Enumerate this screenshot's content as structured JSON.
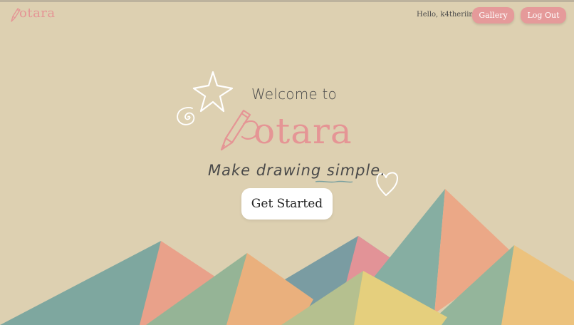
{
  "nav": {
    "logo_text": "otara",
    "greeting": "Hello, k4theriina!",
    "gallery_label": "Gallery",
    "logout_label": "Log Out"
  },
  "hero": {
    "welcome": "Welcome to",
    "logo_text": "otara",
    "tagline": "Make drawing simple.",
    "cta_label": "Get Started"
  },
  "colors": {
    "background": "#ddd0b1",
    "accent_pink": "#e59595",
    "text_dark": "#4a4a4a",
    "mountain_teal": "#7ea79f",
    "mountain_salmon": "#e9a18a",
    "mountain_sage": "#95b496",
    "mountain_peach": "#eab07d",
    "mountain_slate": "#7a9ca2",
    "mountain_rose": "#e29397",
    "mountain_olive": "#b5c08f",
    "mountain_yellow": "#e5cf7d",
    "mountain_gold": "#ecc27d"
  },
  "icons": {
    "logo_pencil": "pencil-icon",
    "star": "star-doodle-icon",
    "swirl": "swirl-doodle-icon",
    "heart": "heart-doodle-icon"
  }
}
